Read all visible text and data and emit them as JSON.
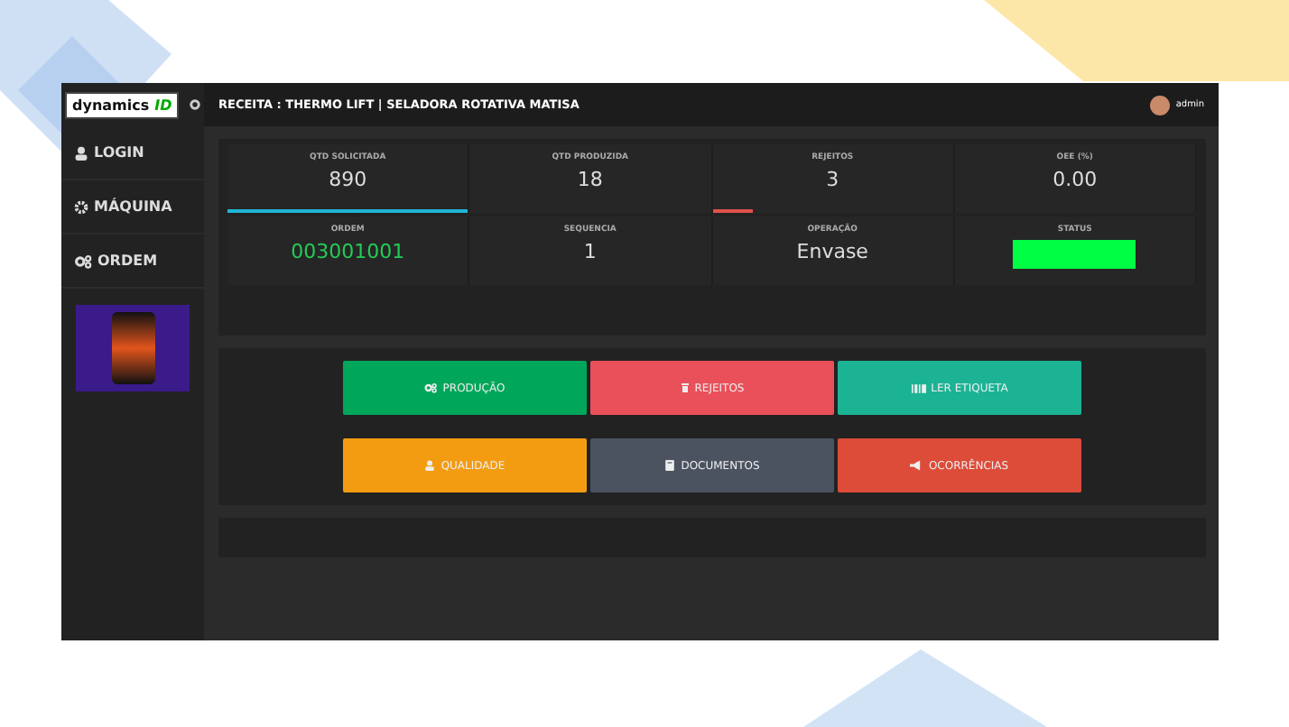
{
  "sidebar": {
    "logo": {
      "text": "dynamics",
      "accent": "ID"
    },
    "items": [
      {
        "label": "LOGIN"
      },
      {
        "label": "MÁQUINA"
      },
      {
        "label": "ORDEM"
      }
    ]
  },
  "header": {
    "title": "RECEITA : THERMO LIFT | SELADORA ROTATIVA MATISA",
    "user": "admin"
  },
  "stats": [
    {
      "label": "QTD SOLICITADA",
      "value": "890",
      "kind": "bar",
      "level": 1.0,
      "color": "#1fb5d6"
    },
    {
      "label": "QTD PRODUZIDA",
      "value": "18",
      "kind": "plain"
    },
    {
      "label": "REJEITOS",
      "value": "3",
      "kind": "bar",
      "level": 0.17,
      "color": "#e0524d"
    },
    {
      "label": "OEE (%)",
      "value": "0.00",
      "kind": "plain"
    },
    {
      "label": "ORDEM",
      "value": "003001001",
      "kind": "highlight"
    },
    {
      "label": "SEQUENCIA",
      "value": "1",
      "kind": "plain"
    },
    {
      "label": "OPERAÇÃO",
      "value": "Envase",
      "kind": "plain"
    },
    {
      "label": "STATUS",
      "kind": "status",
      "color": "#00ff44"
    }
  ],
  "actions": [
    {
      "label": "PRODUÇÃO",
      "color": "#00a65a"
    },
    {
      "label": "REJEITOS",
      "color": "#e9505a"
    },
    {
      "label": "LER ETIQUETA",
      "color": "#1bb394"
    },
    {
      "label": "QUALIDADE",
      "color": "#f39c12"
    },
    {
      "label": "DOCUMENTOS",
      "color": "#4b5361"
    },
    {
      "label": "OCORRÊNCIAS",
      "color": "#dd4b39"
    }
  ]
}
